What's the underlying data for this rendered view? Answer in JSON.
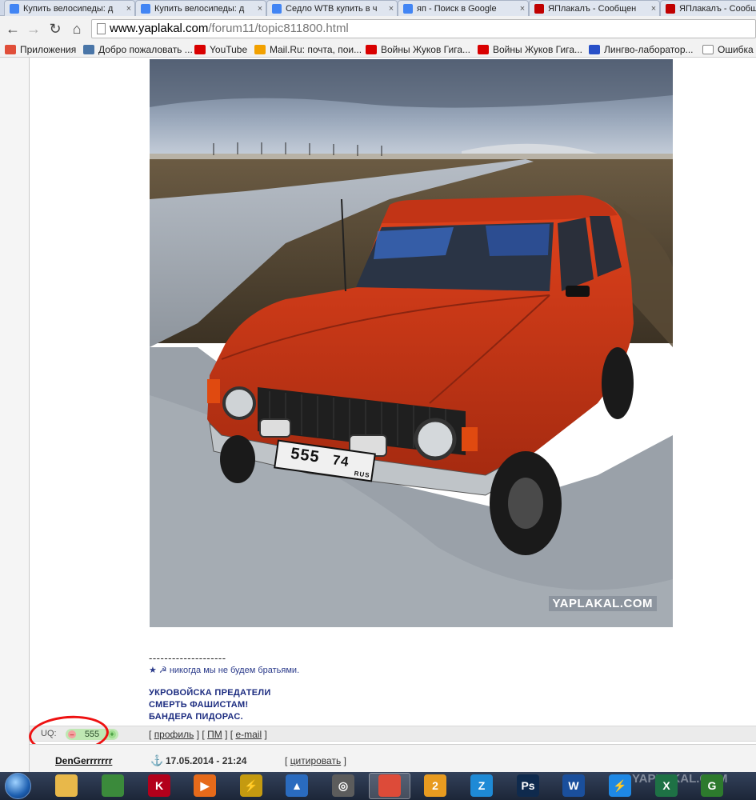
{
  "browser": {
    "tabs": [
      {
        "label": "Купить велосипеды: д",
        "favicon": "google-icon",
        "color": "#4285f4"
      },
      {
        "label": "Купить велосипеды: д",
        "favicon": "google-icon",
        "color": "#4285f4"
      },
      {
        "label": "Седло WTB купить в ч",
        "favicon": "google-icon",
        "color": "#4285f4"
      },
      {
        "label": "яп - Поиск в Google",
        "favicon": "google-g-icon",
        "color": "#4285f4"
      },
      {
        "label": "ЯПлакалъ - Сообщен",
        "favicon": "yaplakal-icon",
        "color": "#c00000"
      },
      {
        "label": "ЯПлакалъ - Сообщ",
        "favicon": "yaplakal-icon",
        "color": "#c00000"
      }
    ],
    "close_glyph": "×",
    "url_host": "www.yaplakal.com",
    "url_path": "/forum11/topic811800.html",
    "bookmarks": [
      {
        "label": "Приложения",
        "icon": "apps-icon",
        "color": "#e04e39"
      },
      {
        "label": "Добро пожаловать ...",
        "icon": "vk-icon",
        "color": "#4a76a8"
      },
      {
        "label": "YouTube",
        "icon": "youtube-icon",
        "color": "#d90000"
      },
      {
        "label": "Mail.Ru: почта, пои...",
        "icon": "mailru-icon",
        "color": "#f2a100"
      },
      {
        "label": "Войны Жуков Гига...",
        "icon": "youtube-icon",
        "color": "#d90000"
      },
      {
        "label": "Войны Жуков Гига...",
        "icon": "youtube-icon",
        "color": "#d90000"
      },
      {
        "label": "Лингво-лаборатор...",
        "icon": "flag-icon",
        "color": "#2850c8"
      },
      {
        "label": "Ошибка R",
        "icon": "page-icon",
        "color": "#ffffff"
      }
    ]
  },
  "post": {
    "image_watermark": "YAPLAKAL.COM",
    "plate": "555",
    "plate_region": "74",
    "plate_country": "RUS",
    "signature_line": "--------------------",
    "signature_text": "★ ☭ никогда мы не будем братьями.",
    "bold_line_1": "УКРОВОЙСКА ПРЕДАТЕЛИ",
    "bold_line_2": "СМЕРТЬ ФАШИСТАМ!",
    "bold_line_3": "БАНДЕРА ПИДОРАС.",
    "uq_label": "UQ:",
    "rating_value": "555",
    "rating_minus": "–",
    "rating_plus": "+",
    "link_profile": "профиль",
    "link_pm": "ПМ",
    "link_email": "e-mail",
    "open_bracket": "[",
    "close_bracket": "]"
  },
  "next_post": {
    "author": "DenGerrrrrrr",
    "anchor_glyph": "⚓",
    "date": "17.05.2014 - 21:24",
    "quote_label": "цитировать"
  },
  "taskbar": {
    "watermark": "YAPLAKAL.COM",
    "items": [
      {
        "name": "explorer-icon",
        "color": "#e8b84a",
        "glyph": ""
      },
      {
        "name": "monitor-app-icon",
        "color": "#3b8a3b",
        "glyph": ""
      },
      {
        "name": "kaspersky-icon",
        "color": "#b3001b",
        "glyph": "K"
      },
      {
        "name": "media-player-icon",
        "color": "#e66a1a",
        "glyph": "▶"
      },
      {
        "name": "winamp-icon",
        "color": "#c49a10",
        "glyph": "⚡"
      },
      {
        "name": "vectorworks-icon",
        "color": "#2a6bbf",
        "glyph": "▲"
      },
      {
        "name": "settings-app-icon",
        "color": "#5c5c5c",
        "glyph": "◎"
      },
      {
        "name": "chrome-icon",
        "color": "#dd4b39",
        "glyph": ""
      },
      {
        "name": "skype-icon",
        "color": "#e89b20",
        "glyph": "2"
      },
      {
        "name": "zoom-icon",
        "color": "#1e8ad6",
        "glyph": "Z"
      },
      {
        "name": "photoshop-icon",
        "color": "#0f2a4d",
        "glyph": "Ps"
      },
      {
        "name": "word-icon",
        "color": "#1a4f9c",
        "glyph": "W"
      },
      {
        "name": "flash-icon",
        "color": "#1e88e5",
        "glyph": "⚡"
      },
      {
        "name": "excel-icon",
        "color": "#1e7145",
        "glyph": "X"
      },
      {
        "name": "other-app-icon",
        "color": "#2d7a2d",
        "glyph": "G"
      }
    ]
  }
}
